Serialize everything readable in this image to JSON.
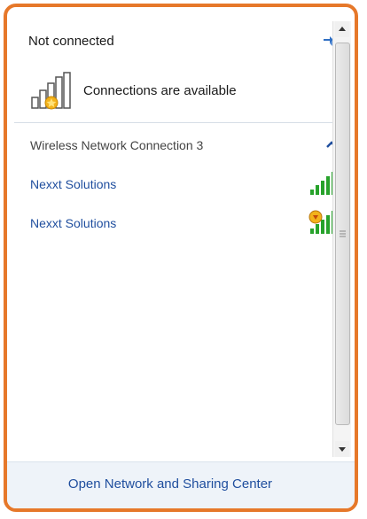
{
  "header": {
    "status": "Not connected",
    "refresh_icon": "refresh-icon"
  },
  "availability": {
    "text": "Connections are available",
    "icon": "signal-star-icon"
  },
  "section": {
    "title": "Wireless Network Connection 3",
    "collapse_icon": "chevron-up-icon"
  },
  "networks": [
    {
      "name": "Nexxt Solutions",
      "icon": "signal-bars-icon"
    },
    {
      "name": "Nexxt Solutions",
      "icon": "signal-bars-secured-icon"
    }
  ],
  "footer": {
    "link": "Open Network and Sharing Center"
  },
  "colors": {
    "frame": "#e6782a",
    "link": "#1f4e9e",
    "signal_green": "#27a22b"
  }
}
